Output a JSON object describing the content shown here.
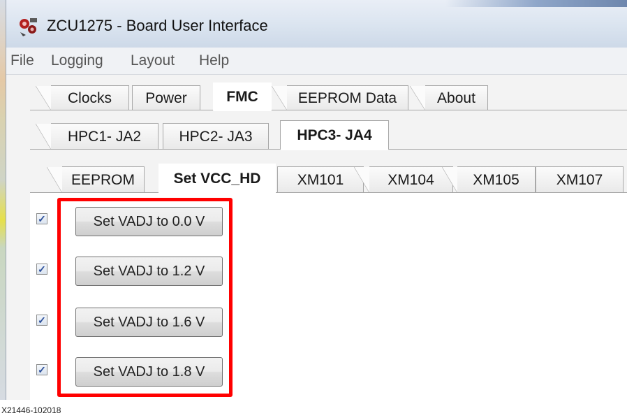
{
  "window": {
    "title": "ZCU1275 - Board User Interface"
  },
  "menu": {
    "items": [
      "File",
      "Logging",
      "Layout",
      "Help"
    ]
  },
  "main_tabs": [
    "Clocks",
    "Power",
    "FMC",
    "EEPROM Data",
    "About"
  ],
  "fmc_tabs": [
    "HPC1- JA2",
    "HPC2- JA3",
    "HPC3- JA4"
  ],
  "sub_tabs": [
    "EEPROM",
    "Set VCC_HD",
    "XM101",
    "XM104",
    "XM105",
    "XM107"
  ],
  "vadj_rows": [
    {
      "label": "Set VADJ to 0.0 V",
      "checked": true
    },
    {
      "label": "Set VADJ to 1.2 V",
      "checked": true
    },
    {
      "label": "Set VADJ to 1.6 V",
      "checked": true
    },
    {
      "label": "Set VADJ to 1.8 V",
      "checked": true
    }
  ],
  "checkbox_glyph": "✓",
  "caption": "X21446-102018",
  "colors": {
    "highlight": "#ff0000",
    "checkmark": "#2a4e9a"
  }
}
